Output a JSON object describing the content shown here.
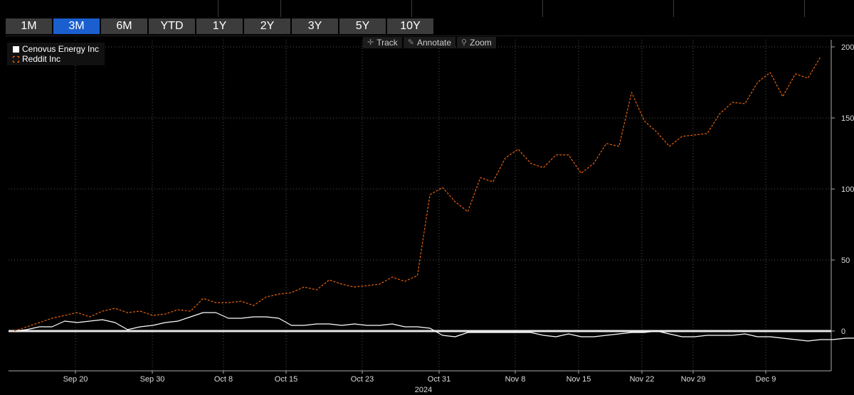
{
  "tabs": [
    {
      "label": "1M",
      "active": false
    },
    {
      "label": "3M",
      "active": true
    },
    {
      "label": "6M",
      "active": false
    },
    {
      "label": "YTD",
      "active": false
    },
    {
      "label": "1Y",
      "active": false
    },
    {
      "label": "2Y",
      "active": false
    },
    {
      "label": "3Y",
      "active": false
    },
    {
      "label": "5Y",
      "active": false
    },
    {
      "label": "10Y",
      "active": false
    }
  ],
  "toolbar": {
    "track_label": "Track",
    "track_icon": "crosshair-icon",
    "annotate_label": "Annotate",
    "annotate_icon": "pencil-icon",
    "zoom_label": "Zoom",
    "zoom_icon": "magnifier-icon"
  },
  "legend": [
    {
      "name": "Cenovus Energy Inc",
      "color": "#ffffff",
      "style": "solid"
    },
    {
      "name": "Reddit Inc",
      "color": "#e8620c",
      "style": "dashed"
    }
  ],
  "chart_data": {
    "type": "line",
    "x_tick_labels": [
      "Sep 20",
      "Sep 30",
      "Oct 8",
      "Oct 15",
      "Oct 23",
      "Oct 31",
      "Nov 8",
      "Nov 15",
      "Nov 22",
      "Nov 29",
      "Dec 9"
    ],
    "x_year_label": "2024",
    "y_ticks": [
      0,
      50,
      100,
      150,
      200
    ],
    "ylim": [
      -28,
      205
    ],
    "grid": true,
    "legend_position": "top-left",
    "series": [
      {
        "name": "Cenovus Energy Inc",
        "color": "#ffffff",
        "style": "solid",
        "values": [
          0,
          1,
          3,
          3,
          7,
          6,
          7,
          8,
          6,
          1,
          3,
          4,
          6,
          7,
          10,
          13,
          13,
          9,
          9,
          10,
          10,
          9,
          4,
          4,
          5,
          5,
          4,
          5,
          4,
          4,
          5,
          3,
          3,
          2,
          -3,
          -4,
          -1,
          -1,
          -1,
          -1,
          -1,
          -1,
          -3,
          -4,
          -2,
          -4,
          -4,
          -3,
          -2,
          -1,
          -1,
          0,
          -2,
          -4,
          -4,
          -3,
          -3,
          -3,
          -2,
          -4,
          -4,
          -5,
          -6,
          -7,
          -6,
          -6,
          -5,
          -5,
          -6,
          -5
        ]
      },
      {
        "name": "Reddit Inc",
        "color": "#e8620c",
        "style": "dashed",
        "values": [
          0,
          3,
          6,
          9,
          11,
          13,
          10,
          14,
          16,
          13,
          14,
          11,
          12,
          15,
          14,
          23,
          20,
          20,
          21,
          18,
          24,
          26,
          27,
          31,
          29,
          36,
          33,
          31,
          32,
          33,
          38,
          35,
          39,
          96,
          101,
          91,
          84,
          108,
          105,
          122,
          128,
          118,
          115,
          124,
          124,
          111,
          118,
          132,
          130,
          168,
          148,
          140,
          130,
          137,
          138,
          139,
          153,
          161,
          160,
          175,
          182,
          165,
          181,
          178,
          193
        ]
      }
    ]
  }
}
